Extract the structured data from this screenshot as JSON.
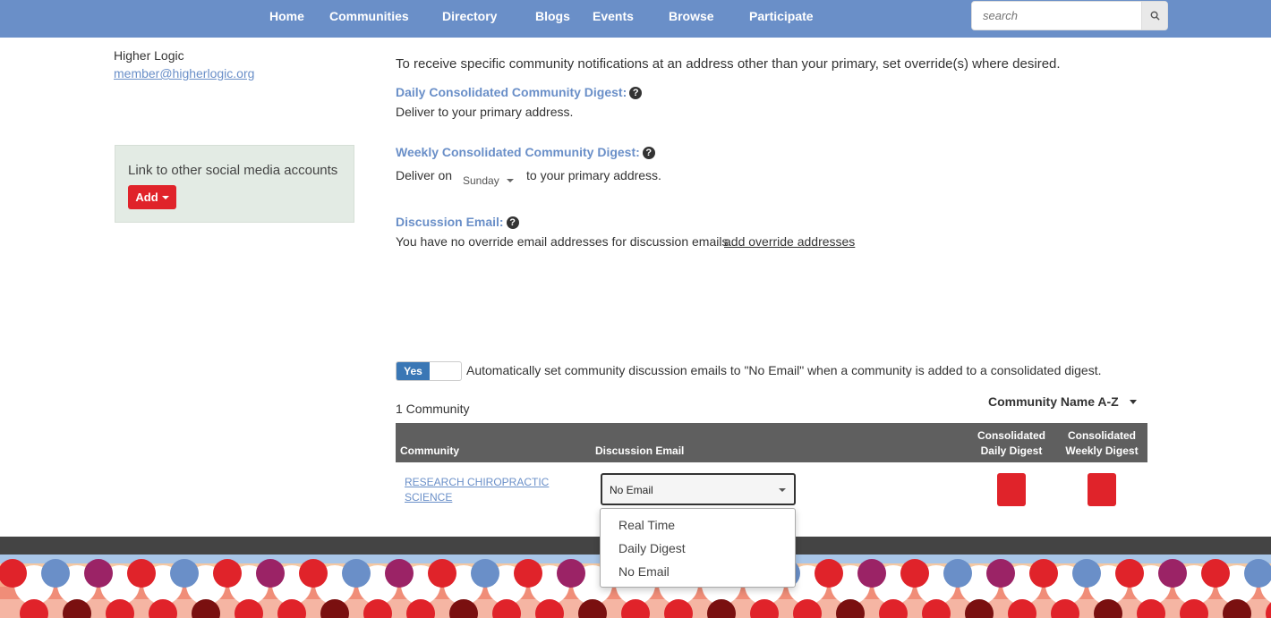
{
  "nav": {
    "items": [
      "Home",
      "Communities",
      "Directory",
      "Blogs",
      "Events",
      "Browse",
      "Participate"
    ],
    "search_placeholder": "search",
    "search_icon": "search-icon"
  },
  "profile": {
    "name": "Higher Logic",
    "email": "member@higherlogic.org"
  },
  "social": {
    "text": "Link to other social media accounts",
    "add_label": "Add"
  },
  "main": {
    "intro": "To receive specific community notifications at an address other than your primary, set override(s) where desired.",
    "daily": {
      "title": "Daily Consolidated Community Digest:",
      "text": "Deliver to your primary address."
    },
    "weekly": {
      "title": "Weekly Consolidated Community Digest:",
      "prefix": "Deliver on",
      "day": "Sunday",
      "suffix": "to your primary address."
    },
    "discussion": {
      "title": "Discussion Email:",
      "text": "You have no override email addresses for discussion emails.",
      "link": "add override addresses"
    },
    "toggle": {
      "label": "Yes",
      "text": "Automatically set community discussion emails to \"No Email\" when a community is added to a consolidated digest."
    },
    "count": "1 Community",
    "sort": "Community Name A-Z"
  },
  "table": {
    "headers": {
      "community": "Community",
      "discussion": "Discussion Email",
      "daily_1": "Consolidated",
      "daily_2": "Daily Digest",
      "weekly_1": "Consolidated",
      "weekly_2": "Weekly Digest"
    },
    "rows": [
      {
        "community_1": "RESEARCH CHIROPRACTIC",
        "community_2": "SCIENCE",
        "discussion": "No Email"
      }
    ]
  },
  "dropdown": {
    "options": [
      "Real Time",
      "Daily Digest",
      "No Email"
    ]
  },
  "colors": {
    "nav": "#6a8fc8",
    "accent_red": "#e0232a",
    "link_blue": "#6a8fc8",
    "toggle_blue": "#3a77b5",
    "table_header": "#5f5f5f"
  }
}
